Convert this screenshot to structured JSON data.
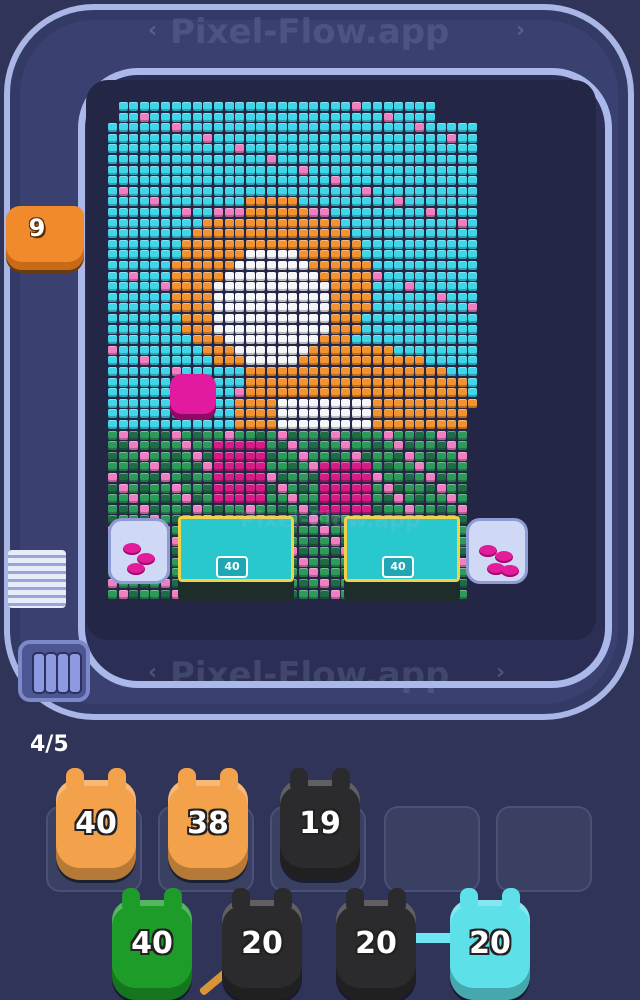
{
  "watermark": {
    "top": "Pixel-Flow.app",
    "middle": "Pixel-Flow.app",
    "board": "Pixel-Flow.app",
    "left": "Pixel-Flow"
  },
  "shooter": {
    "value": "9",
    "color": "#f08a2a"
  },
  "capacity": {
    "text": "4/5"
  },
  "carts": [
    {
      "label": "40"
    },
    {
      "label": "40"
    }
  ],
  "queue_slots": [
    {
      "value": "40",
      "color": "#f3a24b"
    },
    {
      "value": "38",
      "color": "#f3a24b"
    },
    {
      "value": "19",
      "color": "#2b2b2e"
    },
    {
      "value": "",
      "color": ""
    },
    {
      "value": "",
      "color": ""
    }
  ],
  "bottom_pigs": [
    {
      "value": "40",
      "color": "#1e9c2a"
    },
    {
      "value": "20",
      "color": "#2b2b2e"
    },
    {
      "value": "20",
      "color": "#2b2b2e"
    },
    {
      "value": "20",
      "color": "#5ee0e8"
    }
  ],
  "palette": {
    "sky": "#3fd6ea",
    "pink": "#f07fc2",
    "orange": "#f39330",
    "white": "#f5f6fa",
    "magenta": "#d61a86",
    "green": "#2e9a5a",
    "darkgreen": "#1f6b45",
    "black": "#26262c"
  }
}
